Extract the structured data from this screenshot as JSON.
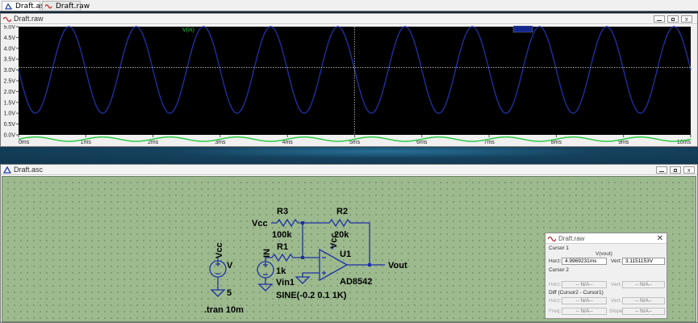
{
  "tabs": [
    {
      "label": "Draft.asc",
      "icon": "schematic-icon",
      "active": true
    },
    {
      "label": "Draft.raw",
      "icon": "waveform-icon",
      "active": false
    }
  ],
  "waveform_window": {
    "title": "Draft.raw",
    "trace_label": "V(in)",
    "chart_data": {
      "type": "line",
      "title": "",
      "xlabel": "",
      "ylabel": "",
      "xlim": [
        0,
        10
      ],
      "ylim": [
        0,
        5
      ],
      "x_unit": "ms",
      "y_unit": "V",
      "x_ticks": [
        "0ms",
        "1ms",
        "2ms",
        "3ms",
        "4ms",
        "5ms",
        "6ms",
        "7ms",
        "8ms",
        "9ms",
        "10ms"
      ],
      "y_ticks": [
        "0.0V",
        "0.5V",
        "1.0V",
        "1.5V",
        "2.0V",
        "2.5V",
        "3.0V",
        "3.5V",
        "4.0V",
        "4.5V",
        "5.0V"
      ],
      "grid": false,
      "background": "#000000",
      "series": [
        {
          "name": "V(in)",
          "color": "#22c83c",
          "kind": "sine",
          "offset": -0.2,
          "amplitude": 0.1,
          "frequency_hz": 1000,
          "phase_deg": 0
        },
        {
          "name": "",
          "color": "#1f2f9e",
          "kind": "sine",
          "offset": 3.0,
          "amplitude": 2.0,
          "frequency_hz": 1000,
          "phase_deg": 180
        }
      ],
      "cursor": {
        "x": 4.9969231,
        "y": 3.1151153,
        "color": "#d9d9d9"
      }
    }
  },
  "schematic_window": {
    "title": "Draft.asc",
    "labels": {
      "r3_name": "R3",
      "r3_value": "100k",
      "r2_name": "R2",
      "r2_value": "20k",
      "r1_name": "R1",
      "r1_value": "1k",
      "u1_name": "U1",
      "u1_part": "AD8542",
      "vcc_left": "Vcc",
      "vcc_src": "Vcc",
      "vcc_opamp": "Vcc",
      "v_src_name": "V",
      "v_src_value": "5",
      "in_label": "IN",
      "vin1_name": "Vin1",
      "vin1_value": "SINE(-0.2 0.1 1K)",
      "vout_label": "Vout",
      "tran_cmd": ".tran 10m"
    }
  },
  "cursor_dialog": {
    "title": "Draft.raw",
    "cursor1_label": "Cursor 1",
    "trace": "V(vout)",
    "horz_label": "Horz:",
    "horz_value": "4.9969231ms",
    "vert_label": "Vert:",
    "vert_value": "3.1151153V",
    "cursor2_label": "Cursor 2",
    "c2_horz_label": "Horz:",
    "c2_horz_value": "-- N/A--",
    "c2_vert_label": "Vert:",
    "c2_vert_value": "-- N/A--",
    "diff_label": "Diff (Cursor2 - Cursor1)",
    "d_horz_label": "Horz:",
    "d_horz_value": "-- N/A--",
    "d_vert_label": "Vert:",
    "d_vert_value": "-- N/A--",
    "freq_label": "Freq:",
    "freq_value": "-- N/A--",
    "slope_label": "Slope:",
    "slope_value": "-- N/A--"
  }
}
